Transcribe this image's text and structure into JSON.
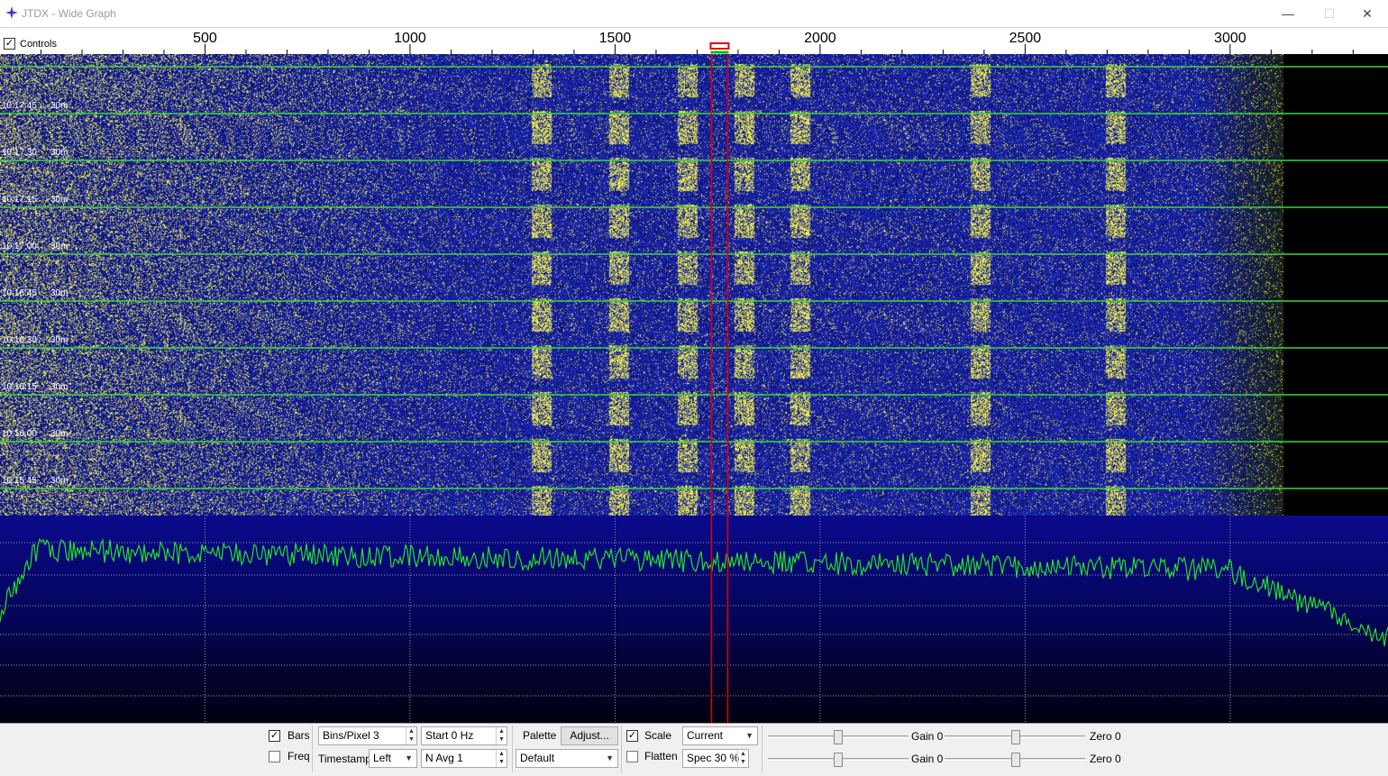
{
  "window": {
    "title": "JTDX - Wide Graph",
    "min_glyph": "—",
    "max_glyph": "☐",
    "close_glyph": "✕"
  },
  "scale": {
    "controls_label": "Controls",
    "controls_checked": true,
    "tick_labels": [
      "500",
      "1000",
      "1500",
      "2000",
      "2500",
      "3000"
    ],
    "tick_freqs": [
      500,
      1000,
      1500,
      2000,
      2500,
      3000
    ],
    "freq_min_hz": 0,
    "freq_max_hz": 3385,
    "rx_marker_hz": 1755,
    "tx_marker_hz": 1755
  },
  "waterfall": {
    "timestamps": [
      "10:17:45",
      "10:17:30",
      "10:17:15",
      "10:17:00",
      "10:16:45",
      "10:16:30",
      "10:16:15",
      "10:16:00",
      "10:15:45"
    ],
    "band": "30m",
    "separator_color": "#3fd23f",
    "signal_freqs_hz": [
      1320,
      1510,
      1675,
      1815,
      1950,
      2390,
      2720
    ],
    "noise_edge_hz": 3040
  },
  "spectrum": {
    "trace_color": "#26e026"
  },
  "controls": {
    "bars_label": "Bars",
    "bars_checked": true,
    "freq_label": "Freq",
    "freq_checked": false,
    "bins_pixel": "Bins/Pixel  3",
    "start_hz": "Start 0 Hz",
    "timestamp_label": "Timestamp",
    "timestamp_value": "Left",
    "navg": "N Avg  1",
    "palette_label": "Palette",
    "adjust_label": "Adjust...",
    "palette_value": "Default",
    "scale_label": "Scale",
    "scale_checked": true,
    "flatten_label": "Flatten",
    "flatten_checked": false,
    "spectrum_mode": "Current",
    "spec_pct": "Spec 30 %",
    "gain1": "Gain 0",
    "zero1": "Zero 0",
    "gain2": "Gain 0",
    "zero2": "Zero 0"
  }
}
